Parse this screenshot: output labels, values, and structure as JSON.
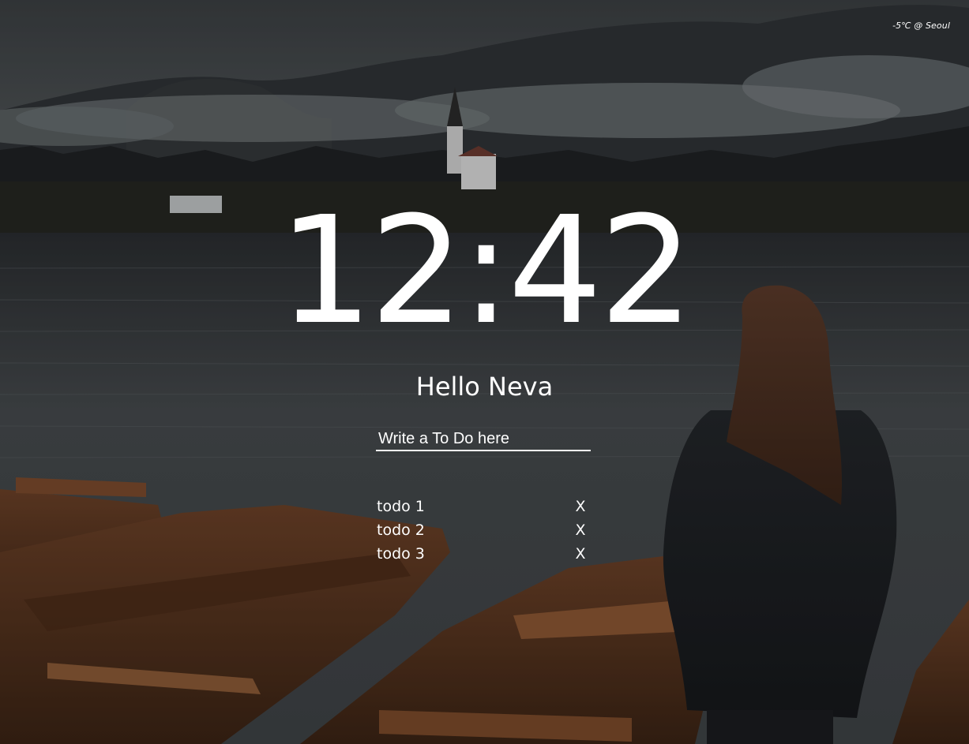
{
  "weather": {
    "text": "-5℃ @ Seoul"
  },
  "clock": {
    "time": "12:42"
  },
  "greeting": {
    "text": "Hello Neva"
  },
  "todo_form": {
    "placeholder": "Write a To Do here"
  },
  "todos": [
    {
      "text": "todo 1",
      "delete_label": "X"
    },
    {
      "text": "todo 2",
      "delete_label": "X"
    },
    {
      "text": "todo 3",
      "delete_label": "X"
    }
  ],
  "colors": {
    "text": "#ffffff",
    "overlay": "#2b2e31"
  }
}
